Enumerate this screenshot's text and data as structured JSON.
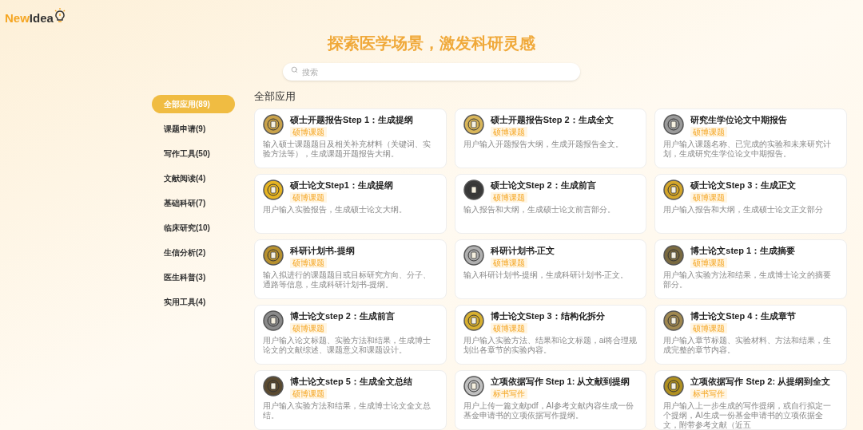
{
  "logo": {
    "text_a": "New",
    "text_b": "Idea"
  },
  "hero": {
    "title": "探索医学场景，激发科研灵感"
  },
  "search": {
    "placeholder": "搜索"
  },
  "sidebar": {
    "items": [
      {
        "label": "全部应用(89)",
        "selected": true
      },
      {
        "label": "课题申请(9)",
        "selected": false
      },
      {
        "label": "写作工具(50)",
        "selected": false
      },
      {
        "label": "文献阅读(4)",
        "selected": false
      },
      {
        "label": "基础科研(7)",
        "selected": false
      },
      {
        "label": "临床研究(10)",
        "selected": false
      },
      {
        "label": "生信分析(2)",
        "selected": false
      },
      {
        "label": "医生科普(3)",
        "selected": false
      },
      {
        "label": "实用工具(4)",
        "selected": false
      }
    ]
  },
  "section_title": "全部应用",
  "apps": [
    {
      "title": "硕士开题报告Step 1：生成提纲",
      "tag": "硕博课题",
      "description": "输入硕士课题题目及相关补充材料（关键词、实验方法等），生成课题开题报告大纲。"
    },
    {
      "title": "硕士开题报告Step 2：生成全文",
      "tag": "硕博课题",
      "description": "用户输入开题报告大纲，生成开题报告全文。"
    },
    {
      "title": "研究生学位论文中期报告",
      "tag": "硕博课题",
      "description": "用户输入课题名称、已完成的实验和未来研究计划，生成研究生学位论文中期报告。"
    },
    {
      "title": "硕士论文Step1：生成提纲",
      "tag": "硕博课题",
      "description": "用户输入实验报告，生成硕士论文大纲。"
    },
    {
      "title": "硕士论文Step 2：生成前言",
      "tag": "硕博课题",
      "description": "输入报告和大纲，生成硕士论文前言部分。"
    },
    {
      "title": "硕士论文Step 3：生成正文",
      "tag": "硕博课题",
      "description": "用户输入报告和大纲，生成硕士论文正文部分"
    },
    {
      "title": "科研计划书-提纲",
      "tag": "硕博课题",
      "description": "输入拟进行的课题题目或目标研究方向、分子、通路等信息，生成科研计划书-提纲。"
    },
    {
      "title": "科研计划书-正文",
      "tag": "硕博课题",
      "description": "输入科研计划书-提纲，生成科研计划书-正文。"
    },
    {
      "title": "博士论文step 1：生成摘要",
      "tag": "硕博课题",
      "description": "用户输入实验方法和结果，生成博士论文的摘要部分。"
    },
    {
      "title": "博士论文step 2：生成前言",
      "tag": "硕博课题",
      "description": "用户输入论文标题、实验方法和结果，生成博士论文的文献综述、课题意义和课题设计。"
    },
    {
      "title": "博士论文Step 3：结构化拆分",
      "tag": "硕博课题",
      "description": "用户输入实验方法、结果和论文标题，ai将合理规划出各章节的实验内容。"
    },
    {
      "title": "博士论文Step 4：生成章节",
      "tag": "硕博课题",
      "description": "用户输入章节标题、实验材料、方法和结果，生成完整的章节内容。"
    },
    {
      "title": "博士论文step 5：生成全文总结",
      "tag": "硕博课题",
      "description": "用户输入实验方法和结果，生成博士论文全文总结。"
    },
    {
      "title": "立项依据写作 Step 1: 从文献到提纲",
      "tag": "标书写作",
      "description": "用户上传一篇文献pdf，AI参考文献内容生成一份基金申请书的立项依据写作提纲。"
    },
    {
      "title": "立项依据写作 Step 2: 从提纲到全文",
      "tag": "标书写作",
      "description": "用户输入上一步生成的写作提纲，或自行拟定一个提纲，AI生成一份基金申请书的立项依据全文，附带参考文献（近五"
    }
  ]
}
